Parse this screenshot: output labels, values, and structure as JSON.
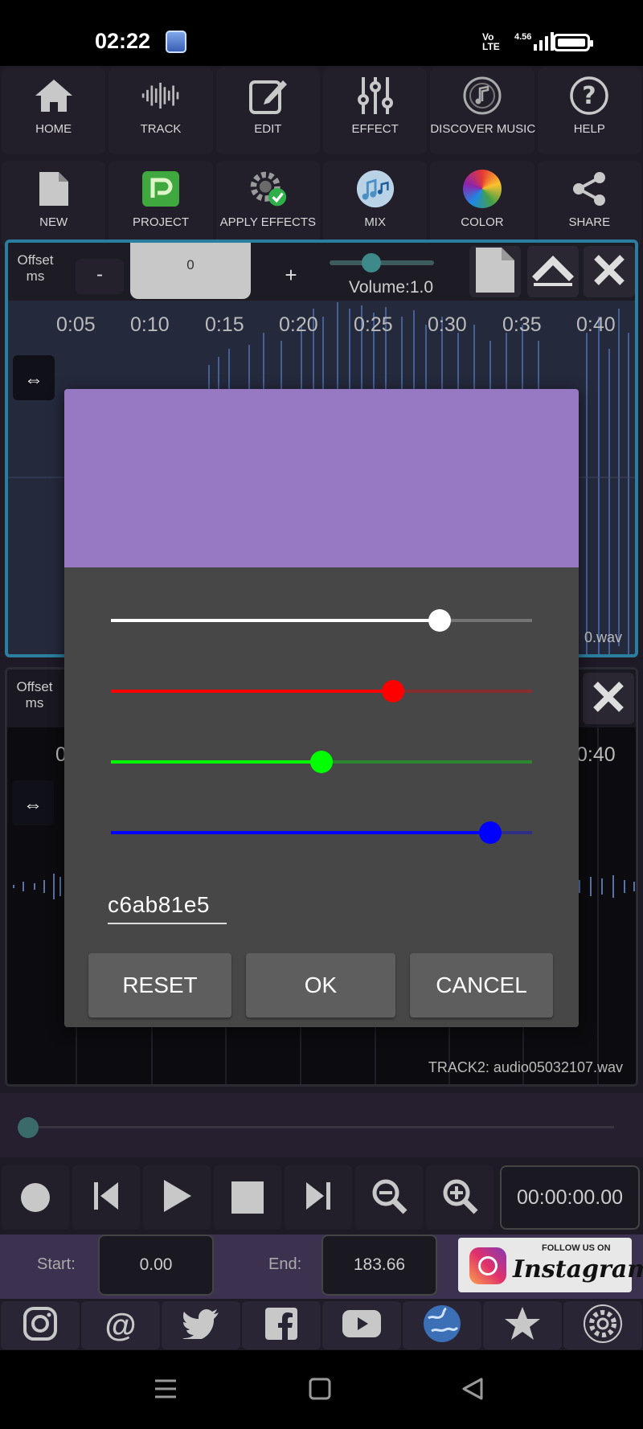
{
  "status_bar": {
    "time": "02:22",
    "volte": "Vo\nLTE",
    "network": "4.56",
    "icons": [
      "gallery-icon",
      "signal-icon",
      "battery-icon"
    ]
  },
  "toolbar_top": [
    {
      "label": "HOME",
      "icon": "home-icon"
    },
    {
      "label": "TRACK",
      "icon": "waveform-icon"
    },
    {
      "label": "EDIT",
      "icon": "edit-icon"
    },
    {
      "label": "EFFECT",
      "icon": "sliders-icon"
    },
    {
      "label": "DISCOVER MUSIC",
      "icon": "music-disc-icon"
    },
    {
      "label": "HELP",
      "icon": "help-icon"
    }
  ],
  "toolbar_second": [
    {
      "label": "NEW",
      "icon": "new-file-icon"
    },
    {
      "label": "PROJECT",
      "icon": "project-icon"
    },
    {
      "label": "APPLY EFFECTS",
      "icon": "gear-check-icon"
    },
    {
      "label": "MIX",
      "icon": "mix-icon"
    },
    {
      "label": "COLOR",
      "icon": "color-wheel-icon"
    },
    {
      "label": "SHARE",
      "icon": "share-icon"
    }
  ],
  "track1": {
    "offset_label": "Offset\nms",
    "minus": "-",
    "offset_value": "0",
    "plus": "+",
    "volume_label": "Volume:1.0",
    "volume_level": 0.4,
    "ticks": [
      "0:05",
      "0:10",
      "0:15",
      "0:20",
      "0:25",
      "0:30",
      "0:35",
      "0:40"
    ],
    "file_suffix": "0.wav"
  },
  "track2": {
    "offset_label": "Offset\nms",
    "tick_left": "0",
    "tick_right": "0:40",
    "name": "TRACK2: audio05032107.wav"
  },
  "transport": {
    "time": "00:00:00.00",
    "buttons": [
      "record-icon",
      "skip-back-icon",
      "play-icon",
      "stop-icon",
      "skip-forward-icon",
      "zoom-out-icon",
      "zoom-in-icon"
    ]
  },
  "range": {
    "start_label": "Start:",
    "start_value": "0.00",
    "end_label": "End:",
    "end_value": "183.66"
  },
  "instagram_banner": {
    "follow": "FOLLOW US ON",
    "brand": "Instagram"
  },
  "social": [
    "instagram-icon",
    "threads-icon",
    "twitter-icon",
    "facebook-icon",
    "youtube-icon",
    "globe-icon",
    "star-icon",
    "settings-icon"
  ],
  "color_dialog": {
    "preview_color": "#9678c3",
    "sliders": [
      {
        "name": "alpha",
        "color": "#ffffff",
        "value": 0.78
      },
      {
        "name": "red",
        "color": "#ff0000",
        "value": 0.67
      },
      {
        "name": "green",
        "color": "#00ff00",
        "value": 0.5
      },
      {
        "name": "blue",
        "color": "#0000ff",
        "value": 0.9
      }
    ],
    "hex_value": "c6ab81e5",
    "reset": "RESET",
    "ok": "OK",
    "cancel": "CANCEL"
  },
  "colors": {
    "app_bg": "#1e1a26",
    "track_border": "#2a7fa0",
    "dialog_bg": "#474747"
  }
}
